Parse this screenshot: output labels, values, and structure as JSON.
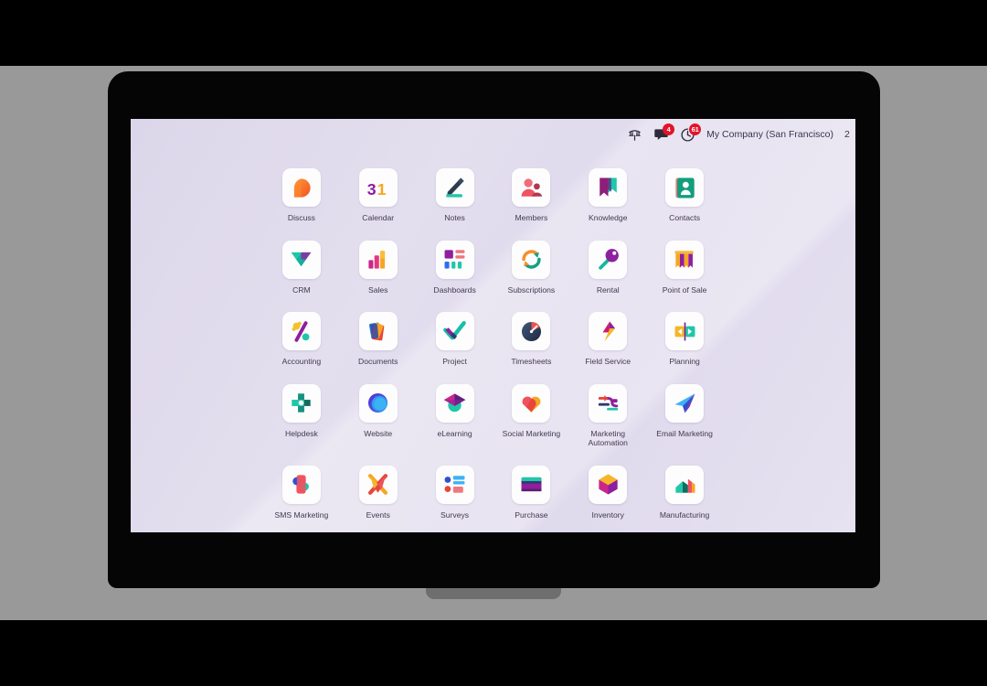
{
  "device": {
    "type": "laptop-mockup",
    "frame_color": "#050505",
    "backdrop_color": "#999999"
  },
  "screen": {
    "background_start": "#dcd6ea",
    "background_end": "#e6e2f0"
  },
  "systray": {
    "phone_icon": "phone-icon",
    "messages_icon": "messages-icon",
    "messages_badge": "4",
    "activity_icon": "activity-clock-icon",
    "activity_badge": "61",
    "company_name": "My Company (San Francisco)",
    "user_name": "2",
    "badge_color": "#e2142a"
  },
  "apps": [
    {
      "label": "Discuss",
      "icon": "discuss-icon"
    },
    {
      "label": "Calendar",
      "icon": "calendar-icon",
      "day": "31"
    },
    {
      "label": "Notes",
      "icon": "notes-icon"
    },
    {
      "label": "Members",
      "icon": "members-icon"
    },
    {
      "label": "Knowledge",
      "icon": "knowledge-icon"
    },
    {
      "label": "Contacts",
      "icon": "contacts-icon"
    },
    {
      "label": "CRM",
      "icon": "crm-icon"
    },
    {
      "label": "Sales",
      "icon": "sales-icon"
    },
    {
      "label": "Dashboards",
      "icon": "dashboards-icon"
    },
    {
      "label": "Subscriptions",
      "icon": "subscriptions-icon"
    },
    {
      "label": "Rental",
      "icon": "rental-key-icon"
    },
    {
      "label": "Point of Sale",
      "icon": "point-of-sale-icon"
    },
    {
      "label": "Accounting",
      "icon": "accounting-percent-icon"
    },
    {
      "label": "Documents",
      "icon": "documents-icon"
    },
    {
      "label": "Project",
      "icon": "project-check-icon"
    },
    {
      "label": "Timesheets",
      "icon": "timesheets-clock-icon"
    },
    {
      "label": "Field Service",
      "icon": "field-service-bolt-icon"
    },
    {
      "label": "Planning",
      "icon": "planning-icon"
    },
    {
      "label": "Helpdesk",
      "icon": "helpdesk-cross-icon"
    },
    {
      "label": "Website",
      "icon": "website-globe-icon"
    },
    {
      "label": "eLearning",
      "icon": "elearning-cap-icon"
    },
    {
      "label": "Social Marketing",
      "icon": "social-marketing-heart-icon"
    },
    {
      "label": "Marketing Automation",
      "icon": "marketing-automation-icon"
    },
    {
      "label": "Email Marketing",
      "icon": "email-marketing-plane-icon"
    },
    {
      "label": "SMS Marketing",
      "icon": "sms-marketing-icon"
    },
    {
      "label": "Events",
      "icon": "events-icon"
    },
    {
      "label": "Surveys",
      "icon": "surveys-icon"
    },
    {
      "label": "Purchase",
      "icon": "purchase-card-icon"
    },
    {
      "label": "Inventory",
      "icon": "inventory-cube-icon"
    },
    {
      "label": "Manufacturing",
      "icon": "manufacturing-icon"
    }
  ]
}
